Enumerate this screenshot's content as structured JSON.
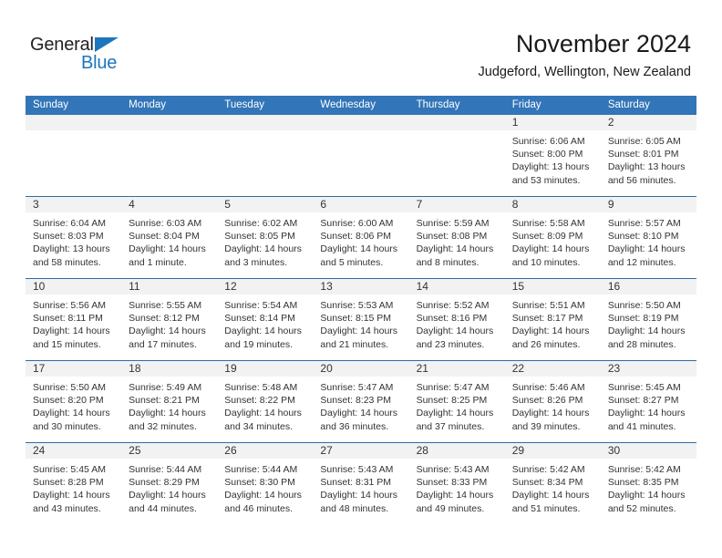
{
  "logo": {
    "word1": "General",
    "word2": "Blue",
    "triangle_color": "#1b76bc",
    "word1_color": "#231f20",
    "word2_color": "#1b76bc"
  },
  "header": {
    "title": "November 2024",
    "subtitle": "Judgeford, Wellington, New Zealand"
  },
  "colors": {
    "header_blue": "#3275b8",
    "row_divider": "#2e6da4",
    "day_band_gray": "#f2f2f2",
    "text": "#333333"
  },
  "weekdays": [
    "Sunday",
    "Monday",
    "Tuesday",
    "Wednesday",
    "Thursday",
    "Friday",
    "Saturday"
  ],
  "weeks": [
    [
      {
        "day": "",
        "blank": true
      },
      {
        "day": "",
        "blank": true
      },
      {
        "day": "",
        "blank": true
      },
      {
        "day": "",
        "blank": true
      },
      {
        "day": "",
        "blank": true
      },
      {
        "day": "1",
        "sunrise": "Sunrise: 6:06 AM",
        "sunset": "Sunset: 8:00 PM",
        "daylight1": "Daylight: 13 hours",
        "daylight2": "and 53 minutes."
      },
      {
        "day": "2",
        "sunrise": "Sunrise: 6:05 AM",
        "sunset": "Sunset: 8:01 PM",
        "daylight1": "Daylight: 13 hours",
        "daylight2": "and 56 minutes."
      }
    ],
    [
      {
        "day": "3",
        "sunrise": "Sunrise: 6:04 AM",
        "sunset": "Sunset: 8:03 PM",
        "daylight1": "Daylight: 13 hours",
        "daylight2": "and 58 minutes."
      },
      {
        "day": "4",
        "sunrise": "Sunrise: 6:03 AM",
        "sunset": "Sunset: 8:04 PM",
        "daylight1": "Daylight: 14 hours",
        "daylight2": "and 1 minute."
      },
      {
        "day": "5",
        "sunrise": "Sunrise: 6:02 AM",
        "sunset": "Sunset: 8:05 PM",
        "daylight1": "Daylight: 14 hours",
        "daylight2": "and 3 minutes."
      },
      {
        "day": "6",
        "sunrise": "Sunrise: 6:00 AM",
        "sunset": "Sunset: 8:06 PM",
        "daylight1": "Daylight: 14 hours",
        "daylight2": "and 5 minutes."
      },
      {
        "day": "7",
        "sunrise": "Sunrise: 5:59 AM",
        "sunset": "Sunset: 8:08 PM",
        "daylight1": "Daylight: 14 hours",
        "daylight2": "and 8 minutes."
      },
      {
        "day": "8",
        "sunrise": "Sunrise: 5:58 AM",
        "sunset": "Sunset: 8:09 PM",
        "daylight1": "Daylight: 14 hours",
        "daylight2": "and 10 minutes."
      },
      {
        "day": "9",
        "sunrise": "Sunrise: 5:57 AM",
        "sunset": "Sunset: 8:10 PM",
        "daylight1": "Daylight: 14 hours",
        "daylight2": "and 12 minutes."
      }
    ],
    [
      {
        "day": "10",
        "sunrise": "Sunrise: 5:56 AM",
        "sunset": "Sunset: 8:11 PM",
        "daylight1": "Daylight: 14 hours",
        "daylight2": "and 15 minutes."
      },
      {
        "day": "11",
        "sunrise": "Sunrise: 5:55 AM",
        "sunset": "Sunset: 8:12 PM",
        "daylight1": "Daylight: 14 hours",
        "daylight2": "and 17 minutes."
      },
      {
        "day": "12",
        "sunrise": "Sunrise: 5:54 AM",
        "sunset": "Sunset: 8:14 PM",
        "daylight1": "Daylight: 14 hours",
        "daylight2": "and 19 minutes."
      },
      {
        "day": "13",
        "sunrise": "Sunrise: 5:53 AM",
        "sunset": "Sunset: 8:15 PM",
        "daylight1": "Daylight: 14 hours",
        "daylight2": "and 21 minutes."
      },
      {
        "day": "14",
        "sunrise": "Sunrise: 5:52 AM",
        "sunset": "Sunset: 8:16 PM",
        "daylight1": "Daylight: 14 hours",
        "daylight2": "and 23 minutes."
      },
      {
        "day": "15",
        "sunrise": "Sunrise: 5:51 AM",
        "sunset": "Sunset: 8:17 PM",
        "daylight1": "Daylight: 14 hours",
        "daylight2": "and 26 minutes."
      },
      {
        "day": "16",
        "sunrise": "Sunrise: 5:50 AM",
        "sunset": "Sunset: 8:19 PM",
        "daylight1": "Daylight: 14 hours",
        "daylight2": "and 28 minutes."
      }
    ],
    [
      {
        "day": "17",
        "sunrise": "Sunrise: 5:50 AM",
        "sunset": "Sunset: 8:20 PM",
        "daylight1": "Daylight: 14 hours",
        "daylight2": "and 30 minutes."
      },
      {
        "day": "18",
        "sunrise": "Sunrise: 5:49 AM",
        "sunset": "Sunset: 8:21 PM",
        "daylight1": "Daylight: 14 hours",
        "daylight2": "and 32 minutes."
      },
      {
        "day": "19",
        "sunrise": "Sunrise: 5:48 AM",
        "sunset": "Sunset: 8:22 PM",
        "daylight1": "Daylight: 14 hours",
        "daylight2": "and 34 minutes."
      },
      {
        "day": "20",
        "sunrise": "Sunrise: 5:47 AM",
        "sunset": "Sunset: 8:23 PM",
        "daylight1": "Daylight: 14 hours",
        "daylight2": "and 36 minutes."
      },
      {
        "day": "21",
        "sunrise": "Sunrise: 5:47 AM",
        "sunset": "Sunset: 8:25 PM",
        "daylight1": "Daylight: 14 hours",
        "daylight2": "and 37 minutes."
      },
      {
        "day": "22",
        "sunrise": "Sunrise: 5:46 AM",
        "sunset": "Sunset: 8:26 PM",
        "daylight1": "Daylight: 14 hours",
        "daylight2": "and 39 minutes."
      },
      {
        "day": "23",
        "sunrise": "Sunrise: 5:45 AM",
        "sunset": "Sunset: 8:27 PM",
        "daylight1": "Daylight: 14 hours",
        "daylight2": "and 41 minutes."
      }
    ],
    [
      {
        "day": "24",
        "sunrise": "Sunrise: 5:45 AM",
        "sunset": "Sunset: 8:28 PM",
        "daylight1": "Daylight: 14 hours",
        "daylight2": "and 43 minutes."
      },
      {
        "day": "25",
        "sunrise": "Sunrise: 5:44 AM",
        "sunset": "Sunset: 8:29 PM",
        "daylight1": "Daylight: 14 hours",
        "daylight2": "and 44 minutes."
      },
      {
        "day": "26",
        "sunrise": "Sunrise: 5:44 AM",
        "sunset": "Sunset: 8:30 PM",
        "daylight1": "Daylight: 14 hours",
        "daylight2": "and 46 minutes."
      },
      {
        "day": "27",
        "sunrise": "Sunrise: 5:43 AM",
        "sunset": "Sunset: 8:31 PM",
        "daylight1": "Daylight: 14 hours",
        "daylight2": "and 48 minutes."
      },
      {
        "day": "28",
        "sunrise": "Sunrise: 5:43 AM",
        "sunset": "Sunset: 8:33 PM",
        "daylight1": "Daylight: 14 hours",
        "daylight2": "and 49 minutes."
      },
      {
        "day": "29",
        "sunrise": "Sunrise: 5:42 AM",
        "sunset": "Sunset: 8:34 PM",
        "daylight1": "Daylight: 14 hours",
        "daylight2": "and 51 minutes."
      },
      {
        "day": "30",
        "sunrise": "Sunrise: 5:42 AM",
        "sunset": "Sunset: 8:35 PM",
        "daylight1": "Daylight: 14 hours",
        "daylight2": "and 52 minutes."
      }
    ]
  ]
}
